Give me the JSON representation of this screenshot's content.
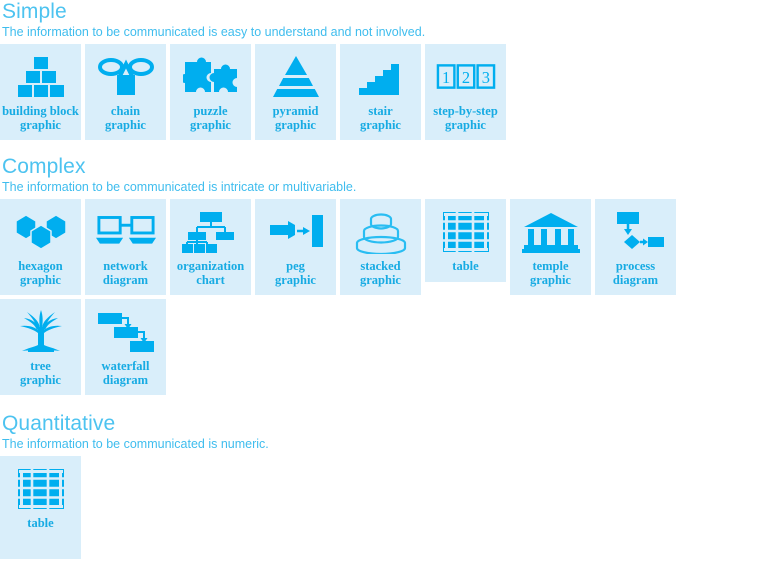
{
  "colors": {
    "card_background": "#D9EEFA",
    "icon_fill": "#00AEEF",
    "label_text": "#17ABE3",
    "heading_text": "#4DC3F0",
    "description_text": "#3FBDEE",
    "page_background": "#FFFFFF"
  },
  "sections": [
    {
      "id": "simple",
      "title": "Simple",
      "description": "The information to be communicated is easy to understand and not involved.",
      "items": [
        {
          "label": "building block\ngraphic",
          "icon": "building-block-icon"
        },
        {
          "label": "chain\ngraphic",
          "icon": "chain-icon"
        },
        {
          "label": "puzzle\ngraphic",
          "icon": "puzzle-icon"
        },
        {
          "label": "pyramid\ngraphic",
          "icon": "pyramid-icon"
        },
        {
          "label": "stair\ngraphic",
          "icon": "stair-icon"
        },
        {
          "label": "step-by-step\ngraphic",
          "icon": "step-by-step-icon"
        }
      ]
    },
    {
      "id": "complex",
      "title": "Complex",
      "description": "The information to be communicated is intricate or multivariable.",
      "items": [
        {
          "label": "hexagon\ngraphic",
          "icon": "hexagon-icon"
        },
        {
          "label": "network\ndiagram",
          "icon": "network-icon"
        },
        {
          "label": "organization\nchart",
          "icon": "org-chart-icon"
        },
        {
          "label": "peg\ngraphic",
          "icon": "peg-icon"
        },
        {
          "label": "stacked\ngraphic",
          "icon": "stacked-icon"
        },
        {
          "label": "table",
          "icon": "table-icon"
        },
        {
          "label": "temple\ngraphic",
          "icon": "temple-icon"
        },
        {
          "label": "process\ndiagram",
          "icon": "process-icon"
        },
        {
          "label": "tree\ngraphic",
          "icon": "tree-icon"
        },
        {
          "label": "waterfall\ndiagram",
          "icon": "waterfall-icon"
        }
      ]
    },
    {
      "id": "quantitative",
      "title": "Quantitative",
      "description": "The information to be communicated is numeric.",
      "items": [
        {
          "label": "table",
          "icon": "table-icon"
        }
      ]
    }
  ],
  "step_numbers": [
    "1",
    "2",
    "3"
  ]
}
